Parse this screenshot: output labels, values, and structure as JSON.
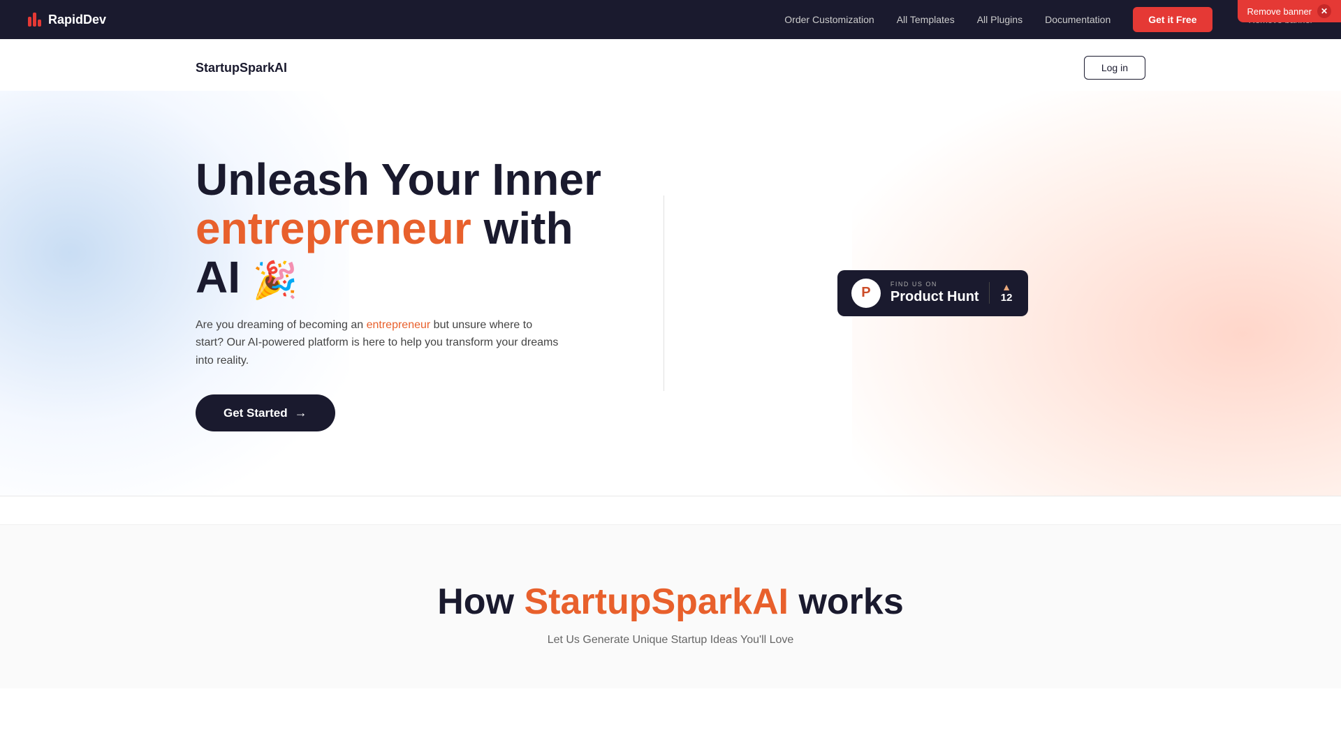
{
  "banner": {
    "text": "Remove banner",
    "close_label": "✕"
  },
  "navbar": {
    "logo_text": "RapidDev",
    "links": [
      {
        "label": "Order Customization",
        "id": "order-customization"
      },
      {
        "label": "All Templates",
        "id": "all-templates"
      },
      {
        "label": "All Plugins",
        "id": "all-plugins"
      },
      {
        "label": "Documentation",
        "id": "documentation"
      }
    ],
    "cta_label": "Get it Free",
    "remove_banner_label": "Remove banner"
  },
  "site_header": {
    "title": "StartupSparkAI",
    "login_label": "Log in"
  },
  "hero": {
    "heading_line1": "Unleash Your Inner",
    "heading_highlight": "entrepreneur",
    "heading_line2": "with AI 🎉",
    "description_prefix": "Are you dreaming of becoming an ",
    "description_link": "entrepreneur",
    "description_suffix": " but unsure where to start? Our AI-powered platform is here to help you transform your dreams into reality.",
    "cta_label": "Get Started",
    "cta_arrow": "→"
  },
  "product_hunt": {
    "find_us": "FIND US ON",
    "name": "Product Hunt",
    "votes": "12",
    "votes_arrow": "▲"
  },
  "how_section": {
    "heading_prefix": "How ",
    "heading_highlight": "StartupSparkAI",
    "heading_suffix": " works",
    "subtitle": "Let Us Generate Unique Startup Ideas You'll Love"
  }
}
